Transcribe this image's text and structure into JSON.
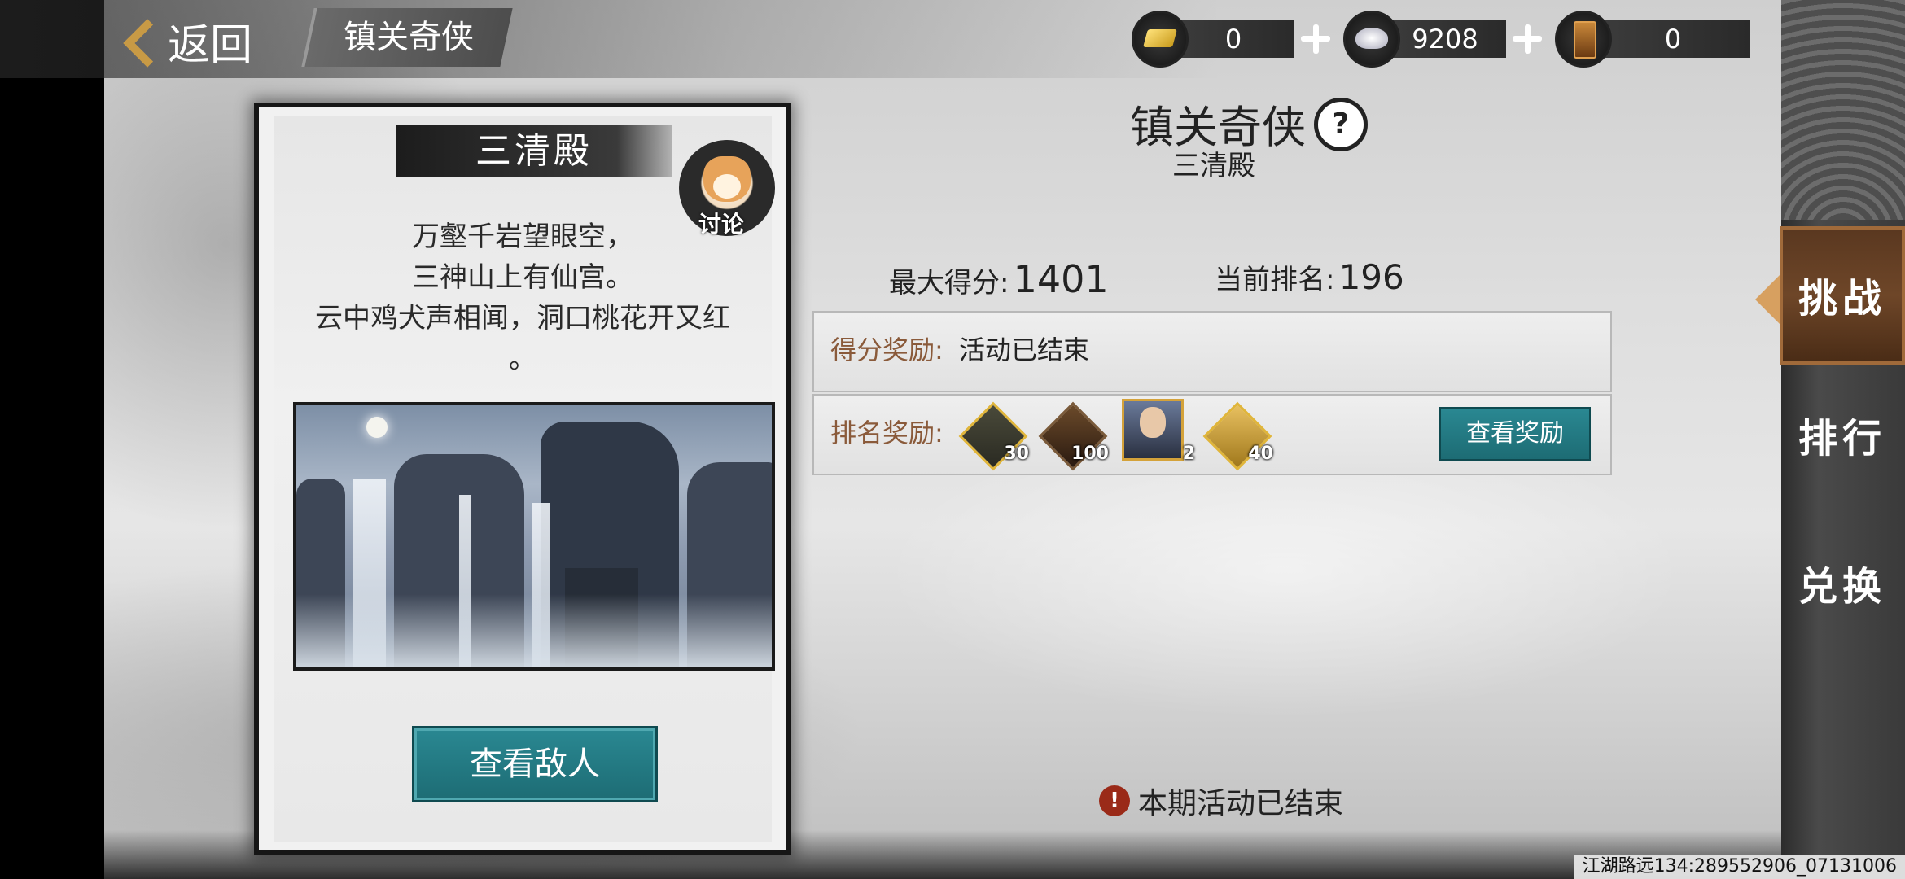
{
  "header": {
    "back_label": "返回",
    "tab_title": "镇关奇侠"
  },
  "currencies": [
    {
      "icon": "gold-ingot-icon",
      "value": "0"
    },
    {
      "icon": "silver-ingot-icon",
      "value": "9208"
    },
    {
      "icon": "token-icon",
      "value": "0"
    }
  ],
  "card": {
    "title": "三清殿",
    "discuss_label": "讨论",
    "poem": [
      "万壑千岩望眼空，",
      "三神山上有仙宫。",
      "云中鸡犬声相闻，洞口桃花开又红",
      "。"
    ],
    "button_label": "查看敌人"
  },
  "event": {
    "title": "镇关奇侠",
    "help_icon_text": "?",
    "subtitle": "三清殿",
    "max_score_label": "最大得分:",
    "max_score": "1401",
    "rank_label": "当前排名:",
    "rank": "196",
    "score_reward_label": "得分奖励:",
    "score_reward_value": "活动已结束",
    "rank_reward_label": "排名奖励:",
    "rank_rewards": [
      {
        "name": "arrows-item-icon",
        "count": "30"
      },
      {
        "name": "token-item-icon",
        "count": "100"
      },
      {
        "name": "hero-portrait-icon",
        "count": "2"
      },
      {
        "name": "scroll-item-icon",
        "count": "40"
      }
    ],
    "view_rewards_label": "查看奖励",
    "ended_notice": "本期活动已结束",
    "ended_icon_text": "!"
  },
  "side_tabs": [
    {
      "label": "挑战",
      "active": true
    },
    {
      "label": "排行",
      "active": false
    },
    {
      "label": "兑换",
      "active": false
    }
  ],
  "footer_text": "江湖路远134:289552906_07131006"
}
